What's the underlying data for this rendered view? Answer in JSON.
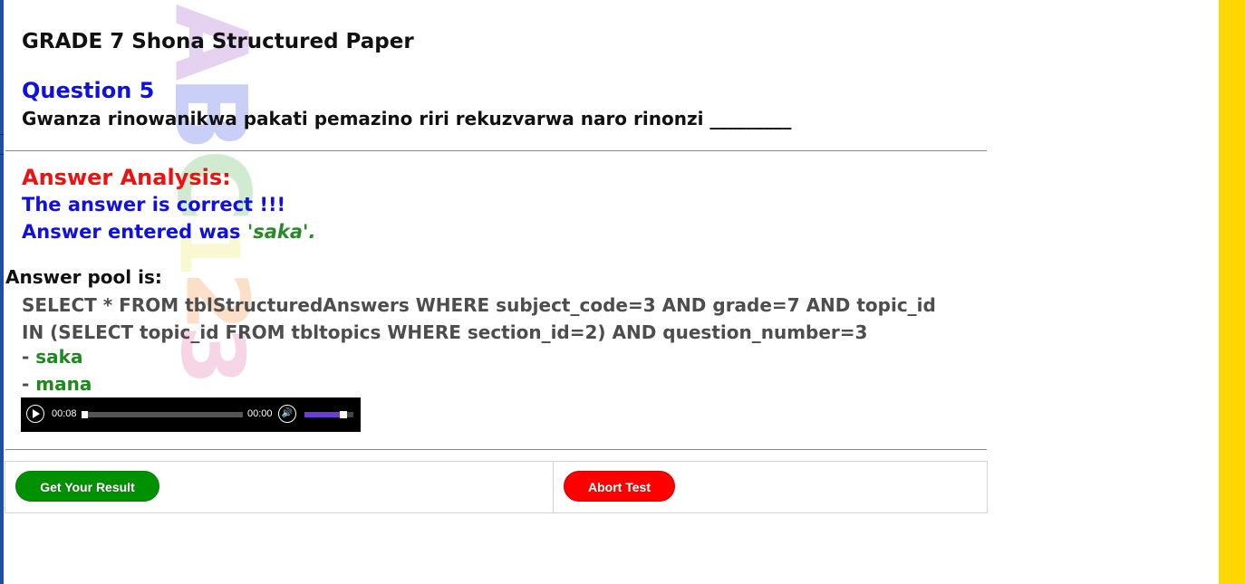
{
  "paper_title": "GRADE 7 Shona Structured Paper",
  "question": {
    "number_label": "Question 5",
    "text": "Gwanza rinowanikwa pakati pemazino riri rekuzvarwa naro rinonzi _________"
  },
  "analysis": {
    "heading": "Answer Analysis:",
    "result": "The answer is correct !!!",
    "entered_prefix": "Answer entered was ",
    "entered_value": "'saka'."
  },
  "answer_pool": {
    "heading": "Answer pool is:",
    "query": "SELECT * FROM tblStructuredAnswers WHERE subject_code=3 AND grade=7 AND topic_id IN (SELECT topic_id FROM tbltopics WHERE section_id=2) AND question_number=3",
    "items": [
      {
        "prefix": "- ",
        "value": "saka"
      },
      {
        "prefix": "- ",
        "value": "mana"
      }
    ]
  },
  "audio_player": {
    "current_time": "00:08",
    "duration": "00:00",
    "progress": 0.0,
    "volume": 0.85
  },
  "actions": {
    "result_label": "Get Your Result",
    "abort_label": "Abort Test"
  },
  "colors": {
    "question_blue": "#1010e0",
    "analysis_red": "#ee1111",
    "answer_green": "#2a8a2a",
    "side_bar_yellow": "#ffd700",
    "result_button": "#009000",
    "abort_button": "#ff0000"
  }
}
